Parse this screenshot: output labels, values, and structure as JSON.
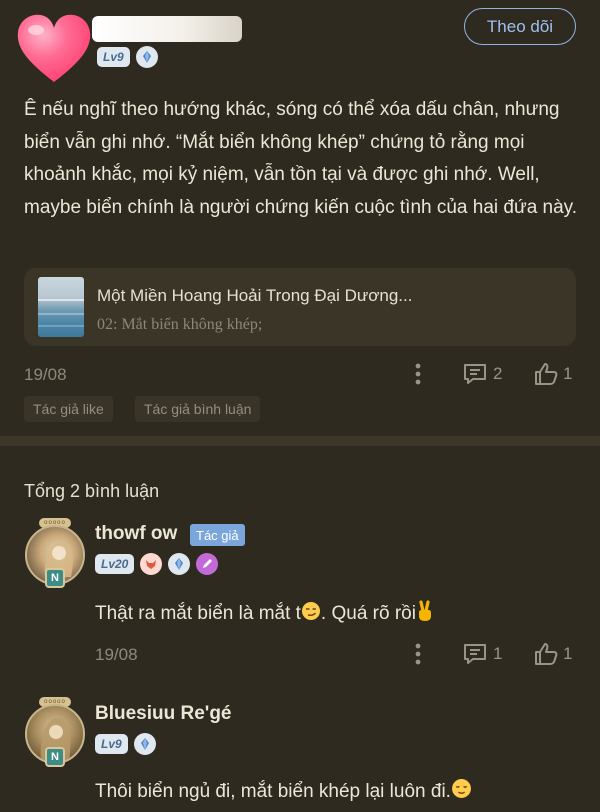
{
  "post": {
    "username": "",
    "level": "Lv9",
    "follow_label": "Theo dõi",
    "text": "Ê nếu nghĩ theo hướng khác, sóng có thể xóa dấu chân, nhưng biển vẫn ghi nhớ. “Mắt biển không khép” chứng tỏ rằng mọi khoảnh khắc, mọi kỷ niệm, vẫn tồn tại và được ghi nhớ. Well, maybe biển chính là người chứng kiến cuộc tình của hai đứa này.",
    "link_card": {
      "title": "Một Miền Hoang Hoải Trong Đại Dương...",
      "subtitle": "02: Mắt biển không khép;"
    },
    "date": "19/08",
    "reply_count": "2",
    "like_count": "1",
    "tags": [
      "Tác giả like",
      "Tác giả bình luận"
    ]
  },
  "total_comments": "Tổng 2 bình luận",
  "comments": [
    {
      "name": "thowf ow",
      "author_tag": "Tác giả",
      "level": "Lv20",
      "text": "Thật ra mắt biển là mắt t",
      "text_after": ". Quá rõ rồi",
      "date": "19/08",
      "reply_count": "1",
      "like_count": "1"
    },
    {
      "name": "Bluesiuu Re'gé",
      "level": "Lv9",
      "text": "Thôi biển ngủ đi, mắt biển khép lại luôn đi. "
    }
  ],
  "frame_text": "ooooo",
  "frame_letter": "N",
  "colors": {
    "background": "#2f2a20",
    "accent": "#8fb3e6",
    "author_tag": "#7aa6dc",
    "heart": "#ff5a86"
  },
  "icons": [
    "heart-icon",
    "diamond-badge-icon",
    "more-vertical-icon",
    "comment-icon",
    "thumbs-up-icon",
    "smirk-emoji",
    "victory-hand-emoji",
    "relieved-emoji"
  ]
}
